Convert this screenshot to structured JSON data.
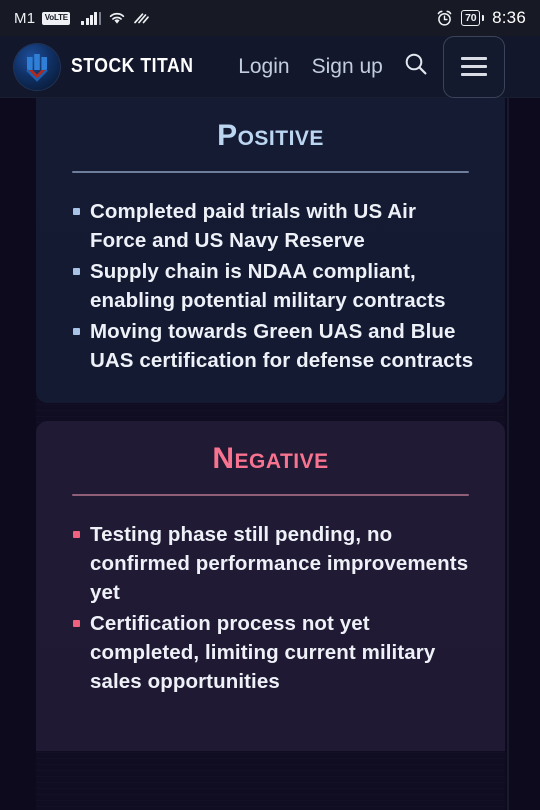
{
  "statusbar": {
    "carrier": "M1",
    "volte_badge": "VoLTE",
    "battery_percent": "70",
    "time": "8:36",
    "icons": [
      "signal-bars-icon",
      "wifi-icon",
      "nfc-icon",
      "alarm-icon",
      "battery-icon"
    ]
  },
  "header": {
    "brand_name": "STOCK TITAN",
    "logo_icon": "stock-titan-logo-icon",
    "login_label": "Login",
    "signup_label": "Sign up",
    "search_icon": "search-icon",
    "menu_icon": "hamburger-menu-icon"
  },
  "sections": [
    {
      "title": "Positive",
      "accent": "#bcd6f2",
      "points": [
        "Completed paid trials with US Air Force and US Navy Reserve",
        "Supply chain is NDAA compliant, enabling potential military contracts",
        "Moving towards Green UAS and Blue UAS certification for defense contracts"
      ]
    },
    {
      "title": "Negative",
      "accent": "#f7738f",
      "points": [
        "Testing phase still pending, no confirmed performance improvements yet",
        "Certification process not yet completed, limiting current military sales opportunities"
      ]
    }
  ]
}
